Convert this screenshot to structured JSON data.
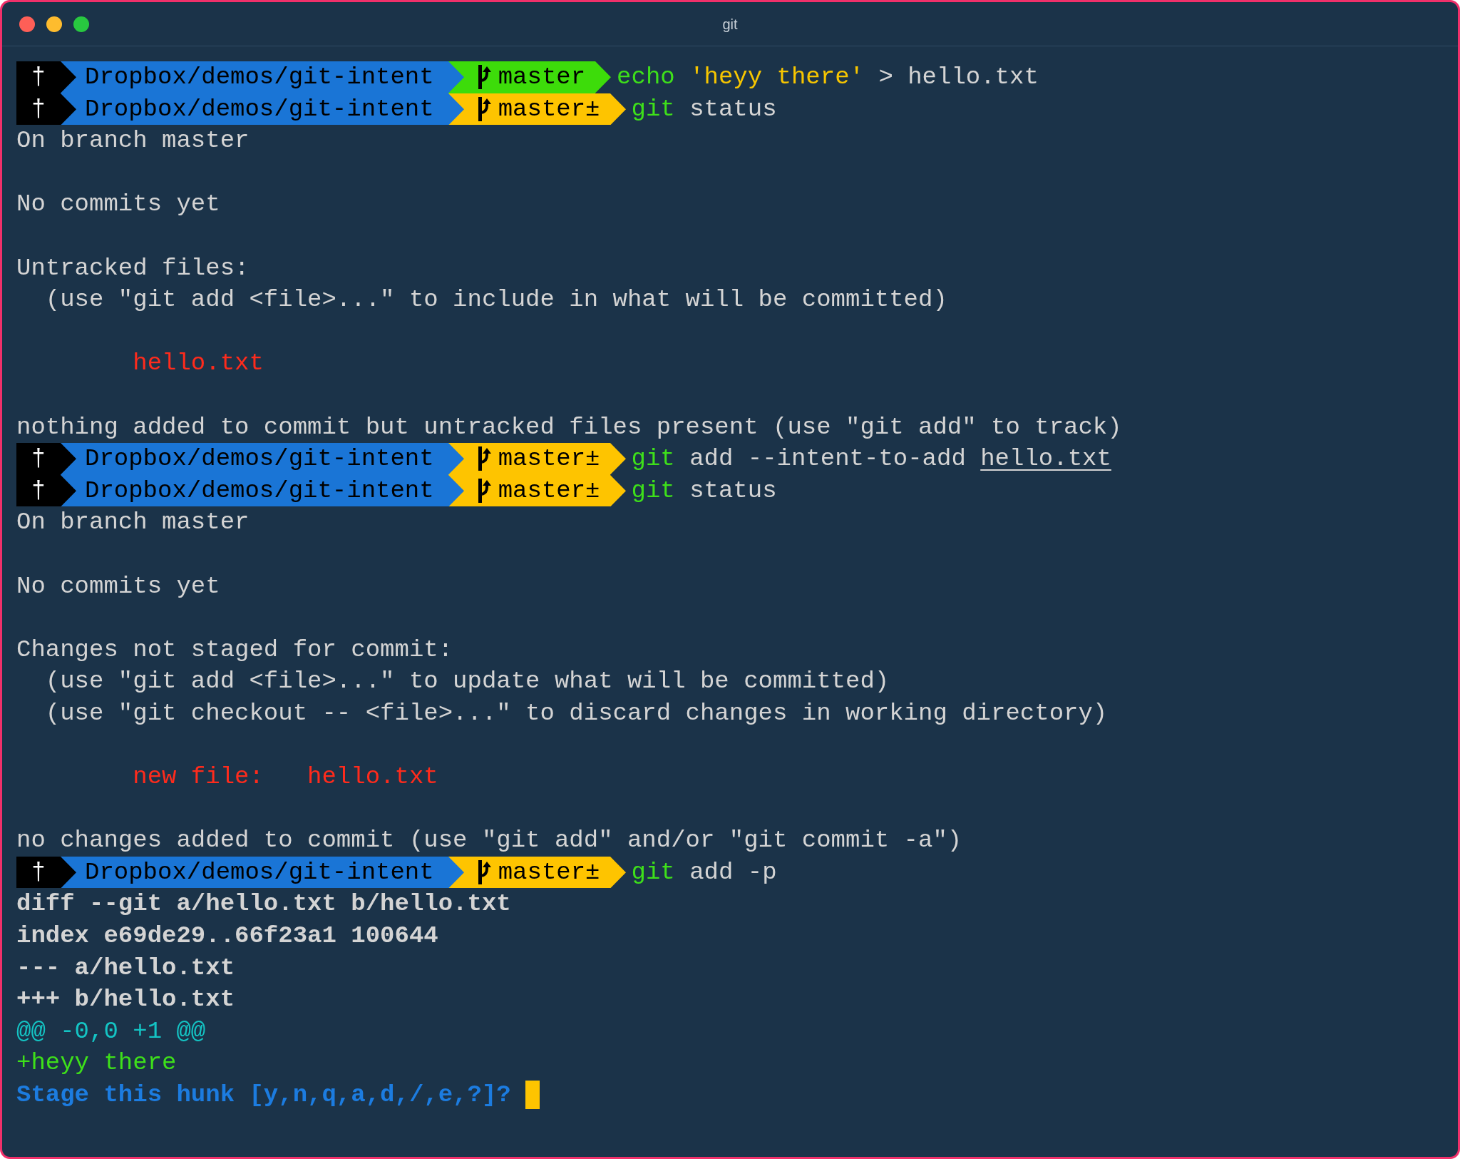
{
  "window": {
    "title": "git"
  },
  "lines": [
    {
      "kind": "prompt",
      "symbol": "†",
      "path": "Dropbox/demos/git-intent",
      "branch": "master",
      "dirty": false,
      "command": [
        {
          "text": "echo ",
          "kind": "command"
        },
        {
          "text": "'heyy there'",
          "kind": "string"
        },
        {
          "text": " > hello.txt",
          "kind": "plain"
        }
      ]
    },
    {
      "kind": "prompt",
      "symbol": "†",
      "path": "Dropbox/demos/git-intent",
      "branch": "master±",
      "dirty": true,
      "command": [
        {
          "text": "git",
          "kind": "command"
        },
        {
          "text": " status",
          "kind": "plain"
        }
      ]
    },
    {
      "kind": "output",
      "segments": [
        {
          "text": "On branch master",
          "kind": "plain"
        }
      ]
    },
    {
      "kind": "blank"
    },
    {
      "kind": "output",
      "segments": [
        {
          "text": "No commits yet",
          "kind": "plain"
        }
      ]
    },
    {
      "kind": "blank"
    },
    {
      "kind": "output",
      "segments": [
        {
          "text": "Untracked files:",
          "kind": "plain"
        }
      ]
    },
    {
      "kind": "output",
      "segments": [
        {
          "text": "  (use \"git add <file>...\" to include in what will be committed)",
          "kind": "plain"
        }
      ]
    },
    {
      "kind": "blank"
    },
    {
      "kind": "output",
      "segments": [
        {
          "text": "        hello.txt",
          "kind": "red"
        }
      ]
    },
    {
      "kind": "blank"
    },
    {
      "kind": "output",
      "segments": [
        {
          "text": "nothing added to commit but untracked files present (use \"git add\" to track)",
          "kind": "plain"
        }
      ]
    },
    {
      "kind": "prompt",
      "symbol": "†",
      "path": "Dropbox/demos/git-intent",
      "branch": "master±",
      "dirty": true,
      "command": [
        {
          "text": "git",
          "kind": "command"
        },
        {
          "text": " add --intent-to-add ",
          "kind": "plain"
        },
        {
          "text": "hello.txt",
          "kind": "underline"
        }
      ]
    },
    {
      "kind": "prompt",
      "symbol": "†",
      "path": "Dropbox/demos/git-intent",
      "branch": "master±",
      "dirty": true,
      "command": [
        {
          "text": "git",
          "kind": "command"
        },
        {
          "text": " status",
          "kind": "plain"
        }
      ]
    },
    {
      "kind": "output",
      "segments": [
        {
          "text": "On branch master",
          "kind": "plain"
        }
      ]
    },
    {
      "kind": "blank"
    },
    {
      "kind": "output",
      "segments": [
        {
          "text": "No commits yet",
          "kind": "plain"
        }
      ]
    },
    {
      "kind": "blank"
    },
    {
      "kind": "output",
      "segments": [
        {
          "text": "Changes not staged for commit:",
          "kind": "plain"
        }
      ]
    },
    {
      "kind": "output",
      "segments": [
        {
          "text": "  (use \"git add <file>...\" to update what will be committed)",
          "kind": "plain"
        }
      ]
    },
    {
      "kind": "output",
      "segments": [
        {
          "text": "  (use \"git checkout -- <file>...\" to discard changes in working directory)",
          "kind": "plain"
        }
      ]
    },
    {
      "kind": "blank"
    },
    {
      "kind": "output",
      "segments": [
        {
          "text": "        new file:   hello.txt",
          "kind": "red"
        }
      ]
    },
    {
      "kind": "blank"
    },
    {
      "kind": "output",
      "segments": [
        {
          "text": "no changes added to commit (use \"git add\" and/or \"git commit -a\")",
          "kind": "plain"
        }
      ]
    },
    {
      "kind": "prompt",
      "symbol": "†",
      "path": "Dropbox/demos/git-intent",
      "branch": "master±",
      "dirty": true,
      "command": [
        {
          "text": "git",
          "kind": "command"
        },
        {
          "text": " add -p",
          "kind": "plain"
        }
      ]
    },
    {
      "kind": "output",
      "segments": [
        {
          "text": "diff --git a/hello.txt b/hello.txt",
          "kind": "bold"
        }
      ]
    },
    {
      "kind": "output",
      "segments": [
        {
          "text": "index e69de29..66f23a1 100644",
          "kind": "bold"
        }
      ]
    },
    {
      "kind": "output",
      "segments": [
        {
          "text": "--- a/hello.txt",
          "kind": "bold"
        }
      ]
    },
    {
      "kind": "output",
      "segments": [
        {
          "text": "+++ b/hello.txt",
          "kind": "bold"
        }
      ]
    },
    {
      "kind": "output",
      "segments": [
        {
          "text": "@@ -0,0 +1 @@",
          "kind": "cyan"
        }
      ]
    },
    {
      "kind": "output",
      "segments": [
        {
          "text": "+heyy there",
          "kind": "green"
        }
      ]
    },
    {
      "kind": "output",
      "segments": [
        {
          "text": "Stage this hunk [y,n,q,a,d,/,e,?]? ",
          "kind": "question"
        }
      ],
      "cursor": true
    }
  ]
}
